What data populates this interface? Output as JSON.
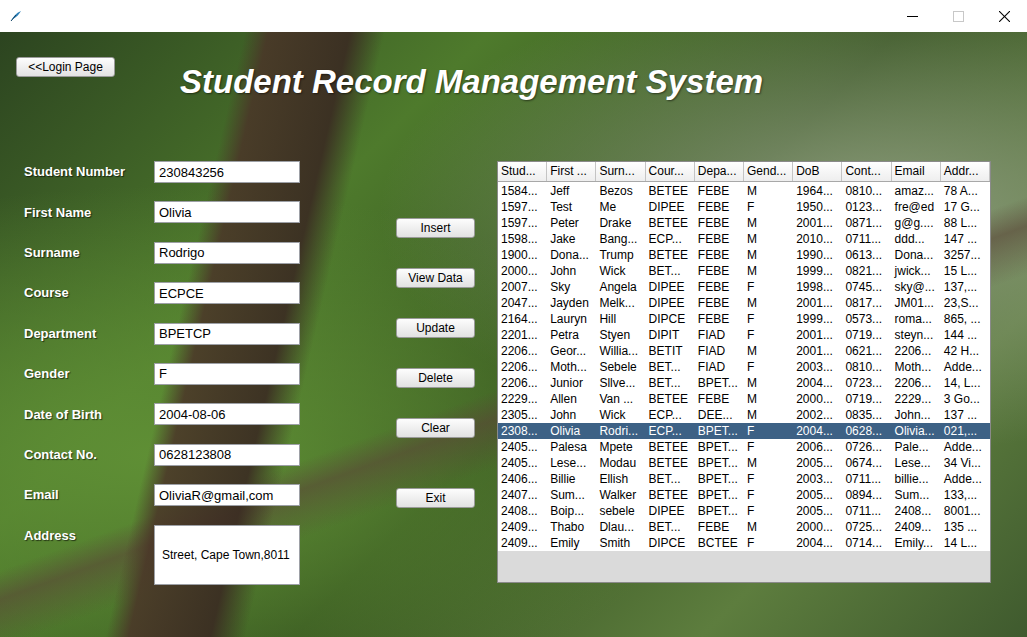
{
  "window": {
    "controls": [
      {
        "kind": "minimize",
        "disabled": false
      },
      {
        "kind": "maximize",
        "disabled": true
      },
      {
        "kind": "close",
        "disabled": false
      }
    ]
  },
  "login_button": "<<Login Page",
  "title": "Student Record Management System",
  "form": {
    "fields": [
      {
        "label": "Student Number",
        "value": "230843256",
        "kind": "text"
      },
      {
        "label": "First Name",
        "value": "Olivia",
        "kind": "text"
      },
      {
        "label": "Surname",
        "value": "Rodrigo",
        "kind": "text"
      },
      {
        "label": "Course",
        "value": "ECPCE",
        "kind": "text"
      },
      {
        "label": "Department",
        "value": "BPETCP",
        "kind": "text"
      },
      {
        "label": "Gender",
        "value": "F",
        "kind": "text"
      },
      {
        "label": "Date of Birth",
        "value": "2004-08-06",
        "kind": "text"
      },
      {
        "label": "Contact No.",
        "value": "0628123808",
        "kind": "text"
      },
      {
        "label": "Email",
        "value": "OliviaR@gmail,com",
        "kind": "text"
      },
      {
        "label": "Address",
        "value": "Street, Cape Town,8011",
        "kind": "textarea"
      }
    ]
  },
  "buttons": [
    "Insert",
    "View Data",
    "Update",
    "Delete",
    "Clear",
    "Exit"
  ],
  "table": {
    "columns": [
      "Stud...",
      "First ...",
      "Surn...",
      "Cour...",
      "Depa...",
      "Gend...",
      "DoB",
      "Cont...",
      "Email",
      "Addr..."
    ],
    "rows": [
      {
        "cells": [
          "1584...",
          "Jeff",
          "Bezos",
          "BETEE",
          "FEBE",
          "M",
          "1964...",
          "0810...",
          "amaz...",
          "78 A..."
        ],
        "selected": false
      },
      {
        "cells": [
          "1597...",
          "Test",
          "Me",
          "DIPEE",
          "FEBE",
          "F",
          "1950...",
          "0123...",
          "fre@ed",
          "17 G..."
        ],
        "selected": false
      },
      {
        "cells": [
          "1597...",
          "Peter",
          "Drake",
          "BETEE",
          "FEBE",
          "M",
          "2001...",
          "0871...",
          "g@g....",
          "88 L..."
        ],
        "selected": false
      },
      {
        "cells": [
          "1598...",
          "Jake",
          "Bang...",
          "ECP...",
          "FEBE",
          "M",
          "2010...",
          "0711...",
          "ddd...",
          "147 ..."
        ],
        "selected": false
      },
      {
        "cells": [
          "1900...",
          "Dona...",
          "Trump",
          "BETEE",
          "FEBE",
          "M",
          "1990...",
          "0613...",
          "Dona...",
          "3257..."
        ],
        "selected": false
      },
      {
        "cells": [
          "2000...",
          "John",
          "Wick",
          "BET...",
          "FEBE",
          "M",
          "1999...",
          "0821...",
          "jwick...",
          "15 L..."
        ],
        "selected": false
      },
      {
        "cells": [
          "2007...",
          "Sky",
          "Angela",
          "DIPEE",
          "FEBE",
          "F",
          "1998...",
          "0745...",
          "sky@...",
          "137,..."
        ],
        "selected": false
      },
      {
        "cells": [
          "2047...",
          "Jayden",
          "Melk...",
          "DIPEE",
          "FEBE",
          "M",
          "2001...",
          "0817...",
          "JM01...",
          "23,S..."
        ],
        "selected": false
      },
      {
        "cells": [
          "2164...",
          "Lauryn",
          "Hill",
          "DIPCE",
          "FEBE",
          "F",
          "1999...",
          "0573...",
          "roma...",
          "865, ..."
        ],
        "selected": false
      },
      {
        "cells": [
          "2201...",
          "Petra",
          "Styen",
          "DIPIT",
          "FIAD",
          "F",
          "2001...",
          "0719...",
          "steyn...",
          "144 ..."
        ],
        "selected": false
      },
      {
        "cells": [
          "2206...",
          "Geor...",
          "Willia...",
          "BETIT",
          "FIAD",
          "M",
          "2001...",
          "0621...",
          "2206...",
          "42 H..."
        ],
        "selected": false
      },
      {
        "cells": [
          "2206...",
          "Moth...",
          "Sebele",
          "BET...",
          "FIAD",
          "F",
          "2003...",
          "0810...",
          "Moth...",
          "Adde..."
        ],
        "selected": false
      },
      {
        "cells": [
          "2206...",
          "Junior",
          "Sllve...",
          "BET...",
          "BPET...",
          "M",
          "2004...",
          "0723...",
          "2206...",
          "14, L..."
        ],
        "selected": false
      },
      {
        "cells": [
          "2229...",
          "Allen",
          "Van ...",
          "BETEE",
          "FEBE",
          "M",
          "2000...",
          "0719...",
          "2229...",
          "3 Go..."
        ],
        "selected": false
      },
      {
        "cells": [
          "2305...",
          "John",
          "Wick",
          "ECP...",
          "DEE...",
          "M",
          "2002...",
          "0835...",
          "John...",
          "137 ..."
        ],
        "selected": false
      },
      {
        "cells": [
          "2308...",
          "Olivia",
          "Rodri...",
          "ECP...",
          "BPET...",
          "F",
          "2004...",
          "0628...",
          "Olivia...",
          "021,..."
        ],
        "selected": true
      },
      {
        "cells": [
          "2405...",
          "Palesa",
          "Mpete",
          "BETEE",
          "BPET...",
          "F",
          "2006...",
          "0726...",
          "Pale...",
          "Adde..."
        ],
        "selected": false
      },
      {
        "cells": [
          "2405...",
          "Lese...",
          "Modau",
          "BETEE",
          "BPET...",
          "M",
          "2005...",
          "0674...",
          "Lese...",
          "34 Vi..."
        ],
        "selected": false
      },
      {
        "cells": [
          "2406...",
          "Billie",
          "Ellish",
          "BET...",
          "BPET...",
          "F",
          "2003...",
          "0711...",
          "billie...",
          "Adde..."
        ],
        "selected": false
      },
      {
        "cells": [
          "2407...",
          "Sum...",
          "Walker",
          "BETEE",
          "BPET...",
          "F",
          "2005...",
          "0894...",
          "Sum...",
          "133,..."
        ],
        "selected": false
      },
      {
        "cells": [
          "2408...",
          "Boip...",
          "sebele",
          "DIPEE",
          "BPET...",
          "F",
          "2005...",
          "0711...",
          "2408...",
          "8001..."
        ],
        "selected": false
      },
      {
        "cells": [
          "2409...",
          "Thabo",
          "Dlau...",
          "BET...",
          "FEBE",
          "M",
          "2000...",
          "0725...",
          "2409...",
          "135 ..."
        ],
        "selected": false
      },
      {
        "cells": [
          "2409...",
          "Emily",
          "Smith",
          "DIPCE",
          "BCTEE",
          "F",
          "2004...",
          "0714...",
          "Emily...",
          "14 L..."
        ],
        "selected": false
      }
    ]
  }
}
